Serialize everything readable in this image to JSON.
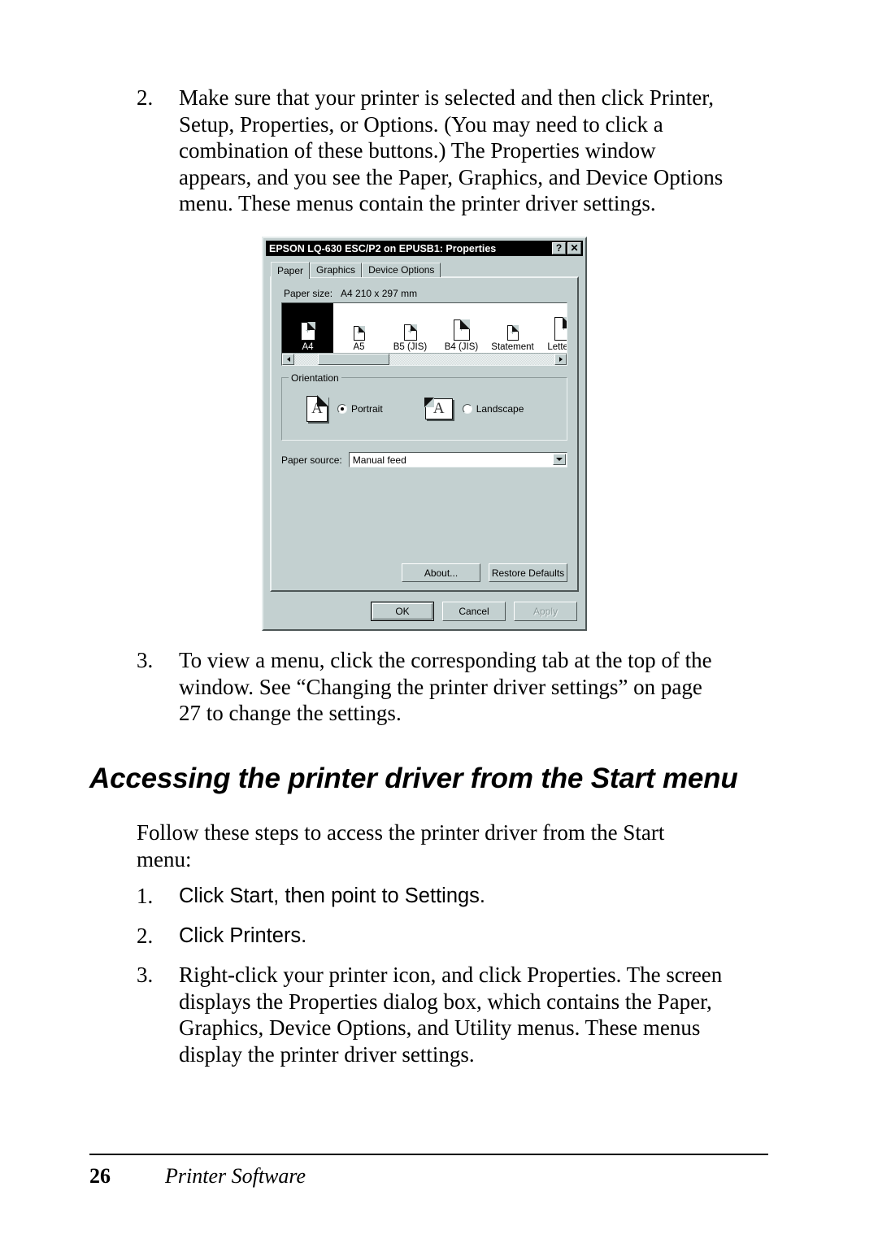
{
  "page": {
    "footer": {
      "page_number": "26",
      "section_label": "Printer Software"
    },
    "heading": "Accessing the printer driver from the Start menu",
    "steps_top": [
      {
        "number": "2.",
        "lines": [
          "Make sure that your printer is selected and then click Printer,",
          "Setup, Properties, or Options. (You may need to click a",
          "combination of these buttons.) The Properties window",
          "appears, and you see the Paper, Graphics, and Device Options",
          "menu. These menus contain the printer driver settings."
        ]
      },
      {
        "number": "3.",
        "lines": [
          "To view a menu, click the corresponding tab at the top of the",
          "window. See “Changing the printer driver settings” on page",
          "27 to change the settings."
        ]
      }
    ],
    "intro_paragraph": [
      "Follow these steps to access the printer driver from the Start",
      "menu:"
    ],
    "steps_bottom": [
      {
        "number": "1.",
        "lines": [
          "Click Start, then point to Settings."
        ]
      },
      {
        "number": "2.",
        "lines": [
          "Click Printers."
        ]
      },
      {
        "number": "3.",
        "lines": [
          "Right-click your printer icon, and click Properties. The screen",
          "displays the Properties dialog box, which contains the Paper,",
          "Graphics, Device Options, and Utility menus. These menus",
          "display the printer driver settings."
        ]
      }
    ]
  },
  "dialog": {
    "title": "EPSON LQ-630 ESC/P2 on EPUSB1: Properties",
    "titlebar_buttons": [
      {
        "name": "help-button",
        "glyph": "?"
      },
      {
        "name": "close-button",
        "glyph": "✕"
      }
    ],
    "tabs": [
      {
        "label": "Paper",
        "active": true
      },
      {
        "label": "Graphics",
        "active": false
      },
      {
        "label": "Device Options",
        "active": false
      }
    ],
    "paper_size": {
      "label": "Paper size:",
      "value": "A4 210 x 297 mm",
      "options": [
        {
          "label": "A4",
          "selected": true
        },
        {
          "label": "A5",
          "selected": false
        },
        {
          "label": "B5 (JIS)",
          "selected": false
        },
        {
          "label": "B4 (JIS)",
          "selected": false
        },
        {
          "label": "Statement",
          "selected": false
        },
        {
          "label": "Letter P",
          "selected": false
        }
      ]
    },
    "orientation": {
      "group_label": "Orientation",
      "portrait_label": "Portrait",
      "landscape_label": "Landscape",
      "selected": "Portrait",
      "icon_letter": "A"
    },
    "paper_source": {
      "label": "Paper source:",
      "value": "Manual feed"
    },
    "page_buttons": [
      {
        "label": "About...",
        "enabled": true
      },
      {
        "label": "Restore Defaults",
        "enabled": true
      }
    ],
    "dialog_buttons": [
      {
        "label": "OK",
        "enabled": true,
        "default": true
      },
      {
        "label": "Cancel",
        "enabled": true,
        "default": false
      },
      {
        "label": "Apply",
        "enabled": false,
        "default": false
      }
    ],
    "colors": {
      "face": "#c3d0d0",
      "titlebar": "#000000",
      "selection": "#000000"
    }
  }
}
